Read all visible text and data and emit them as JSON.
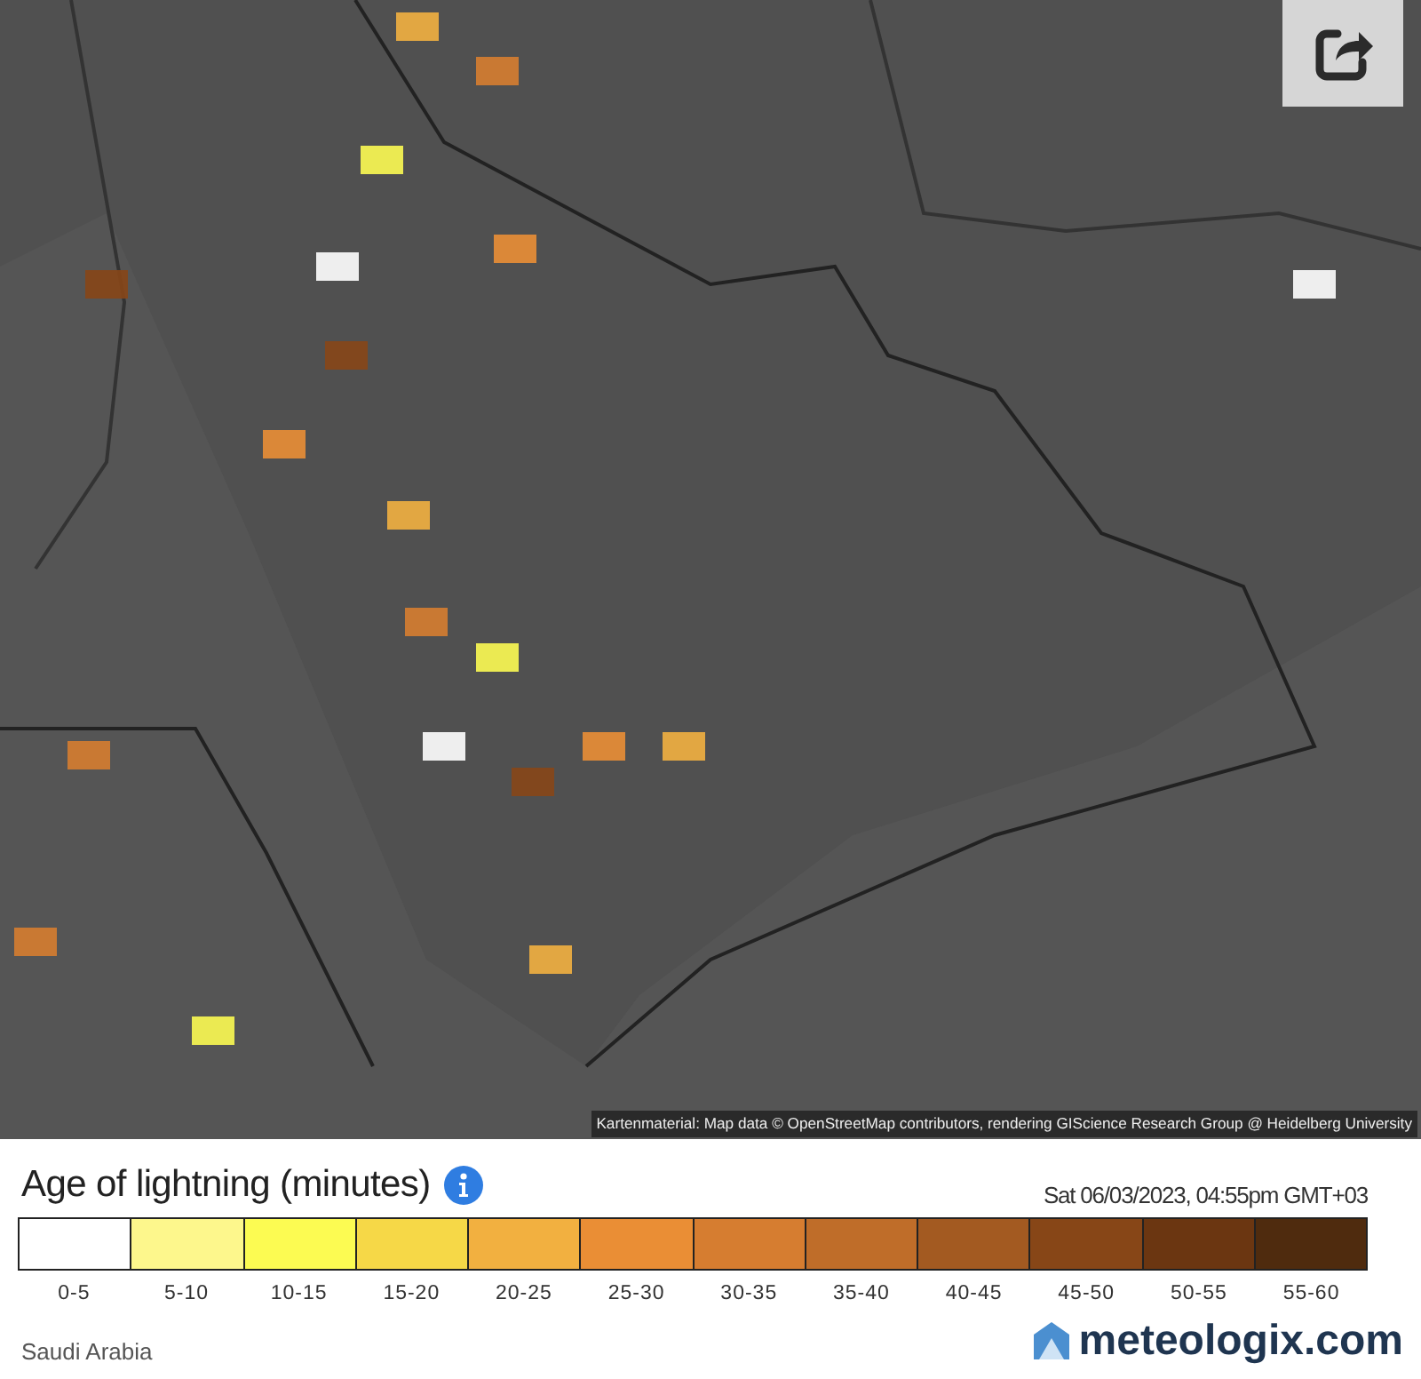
{
  "map": {
    "attribution": "Kartenmaterial: Map data © OpenStreetMap contributors, rendering GIScience Research Group @ Heidelberg University"
  },
  "legend": {
    "title": "Age of lightning (minutes)",
    "timestamp": "Sat 06/03/2023, 04:55pm GMT+03",
    "classes": [
      {
        "label": "0-5",
        "color": "#ffffff"
      },
      {
        "label": "5-10",
        "color": "#fdf78c"
      },
      {
        "label": "10-15",
        "color": "#fcfb52"
      },
      {
        "label": "15-20",
        "color": "#f6d847"
      },
      {
        "label": "20-25",
        "color": "#f2b040"
      },
      {
        "label": "25-30",
        "color": "#ea8e35"
      },
      {
        "label": "30-35",
        "color": "#d67d30"
      },
      {
        "label": "35-40",
        "color": "#bf6d29"
      },
      {
        "label": "40-45",
        "color": "#a35a21"
      },
      {
        "label": "45-50",
        "color": "#874617"
      },
      {
        "label": "50-55",
        "color": "#6b3611"
      },
      {
        "label": "55-60",
        "color": "#4f2b0e"
      }
    ]
  },
  "footer": {
    "region": "Saudi Arabia",
    "brand": "meteologix.com"
  }
}
